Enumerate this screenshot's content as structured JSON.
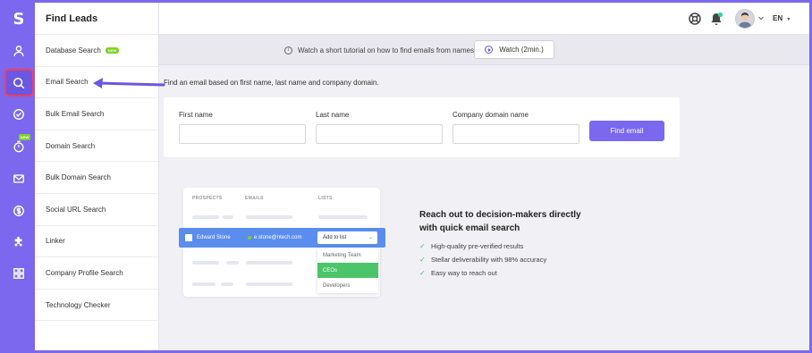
{
  "app": {
    "logo": "S",
    "rail_new_badge": "NEW"
  },
  "sidebar": {
    "title": "Find Leads",
    "items": [
      {
        "label": "Database Search",
        "badge": "NEW"
      },
      {
        "label": "Email Search"
      },
      {
        "label": "Bulk Email Search"
      },
      {
        "label": "Domain Search"
      },
      {
        "label": "Bulk Domain Search"
      },
      {
        "label": "Social URL Search"
      },
      {
        "label": "Linker"
      },
      {
        "label": "Company Profile Search"
      },
      {
        "label": "Technology Checker"
      }
    ]
  },
  "topbar": {
    "language": "EN"
  },
  "tutorial": {
    "text": "Watch a short tutorial on how to find emails from names",
    "button_label": "Watch (2min.)"
  },
  "main": {
    "subtitle": "Find an email based on first name, last name and company domain.",
    "form": {
      "first_name_label": "First name",
      "first_name_value": "",
      "last_name_label": "Last name",
      "last_name_value": "",
      "domain_label": "Company domain name",
      "domain_value": "",
      "submit_label": "Find email"
    }
  },
  "illustration": {
    "headers": [
      "PROSPECTS",
      "EMAILS",
      "LISTS"
    ],
    "row_name": "Edward Stone",
    "row_email": "e.stone@ntech.com",
    "dropdown_label": "Add to list",
    "dropdown_options": [
      "Marketing Team",
      "CEOs",
      "Developers"
    ]
  },
  "promo": {
    "title": "Reach out to decision-makers directly with quick email search",
    "points": [
      "High-quality pre-verified results",
      "Stellar deliverability with 98% accuracy",
      "Easy way to reach out"
    ]
  },
  "colors": {
    "accent": "#7b68ee",
    "highlight_row": "#5b8def",
    "success": "#4cc46a",
    "new_badge": "#7ed321",
    "annotation": "#ff3b5c"
  }
}
